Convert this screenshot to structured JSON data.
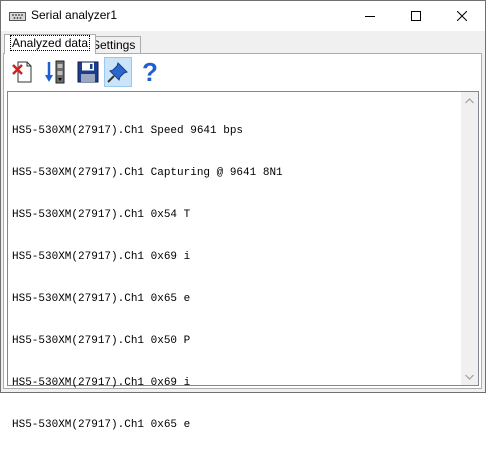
{
  "window": {
    "title": "Serial analyzer1",
    "icon": "serial-port-icon"
  },
  "tabs": [
    {
      "label": "Analyzed data",
      "active": true
    },
    {
      "label": "Settings",
      "active": false
    }
  ],
  "toolbar": {
    "buttons": [
      {
        "name": "clear-icon"
      },
      {
        "name": "import-icon"
      },
      {
        "name": "save-icon"
      },
      {
        "name": "pin-icon",
        "pressed": true
      },
      {
        "name": "help-icon",
        "glyph": "?"
      }
    ]
  },
  "log": {
    "lines": [
      "HS5-530XM(27917).Ch1 Speed 9641 bps",
      "HS5-530XM(27917).Ch1 Capturing @ 9641 8N1",
      "HS5-530XM(27917).Ch1 0x54 T",
      "HS5-530XM(27917).Ch1 0x69 i",
      "HS5-530XM(27917).Ch1 0x65 e",
      "HS5-530XM(27917).Ch1 0x50 P",
      "HS5-530XM(27917).Ch1 0x69 i",
      "HS5-530XM(27917).Ch1 0x65 e"
    ]
  }
}
